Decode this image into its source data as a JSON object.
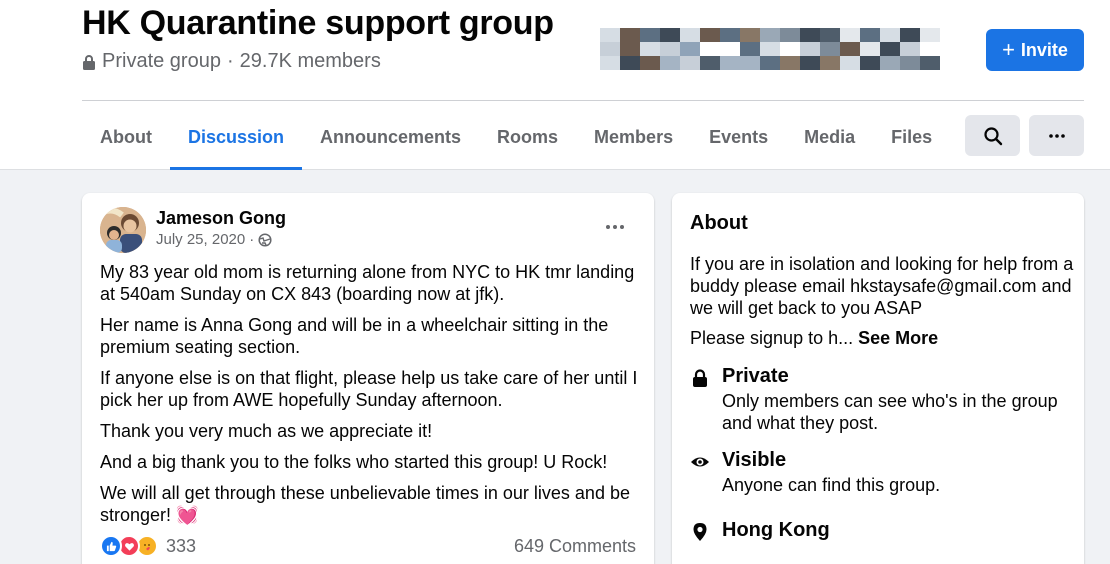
{
  "group": {
    "title": "HK Quarantine support group",
    "privacy": "Private group",
    "separator": "·",
    "members": "29.7K members",
    "invite_label": "Invite"
  },
  "tabs": [
    {
      "label": "About",
      "active": false
    },
    {
      "label": "Discussion",
      "active": true
    },
    {
      "label": "Announcements",
      "active": false
    },
    {
      "label": "Rooms",
      "active": false
    },
    {
      "label": "Members",
      "active": false
    },
    {
      "label": "Events",
      "active": false
    },
    {
      "label": "Media",
      "active": false
    },
    {
      "label": "Files",
      "active": false
    }
  ],
  "post": {
    "author": "Jameson Gong",
    "date": "July 25, 2020",
    "date_separator": "·",
    "paragraphs": [
      "My 83 year old mom is returning alone from NYC to HK tmr landing at 540am Sunday on CX 843 (boarding now at jfk).",
      "Her name is Anna Gong and will be in a wheelchair sitting in the premium seating section.",
      "If anyone else is on that flight, please help us take care of her until I pick her up from AWE hopefully Sunday afternoon.",
      "Thank you very much as we appreciate it!",
      "And a big thank you to the folks who started this group! U Rock!",
      "We will all get through these unbelievable times in our lives and be stronger! 💓"
    ],
    "reaction_count": "333",
    "comments": "649 Comments"
  },
  "about": {
    "title": "About",
    "description": "If you are in isolation and looking for help from a buddy please email hkstaysafe@gmail.com and we will get back to you ASAP",
    "signup_preview": "Please signup to h...",
    "see_more": "See More",
    "private_title": "Private",
    "private_text": "Only members can see who's in the group and what they post.",
    "visible_title": "Visible",
    "visible_text": "Anyone can find this group.",
    "location": "Hong Kong"
  },
  "colors": {
    "accent": "#1b74e4",
    "background": "#f0f2f5",
    "secondary_text": "#65676b",
    "like": "#1877f2",
    "love": "#f33e58",
    "care": "#f7b125"
  }
}
